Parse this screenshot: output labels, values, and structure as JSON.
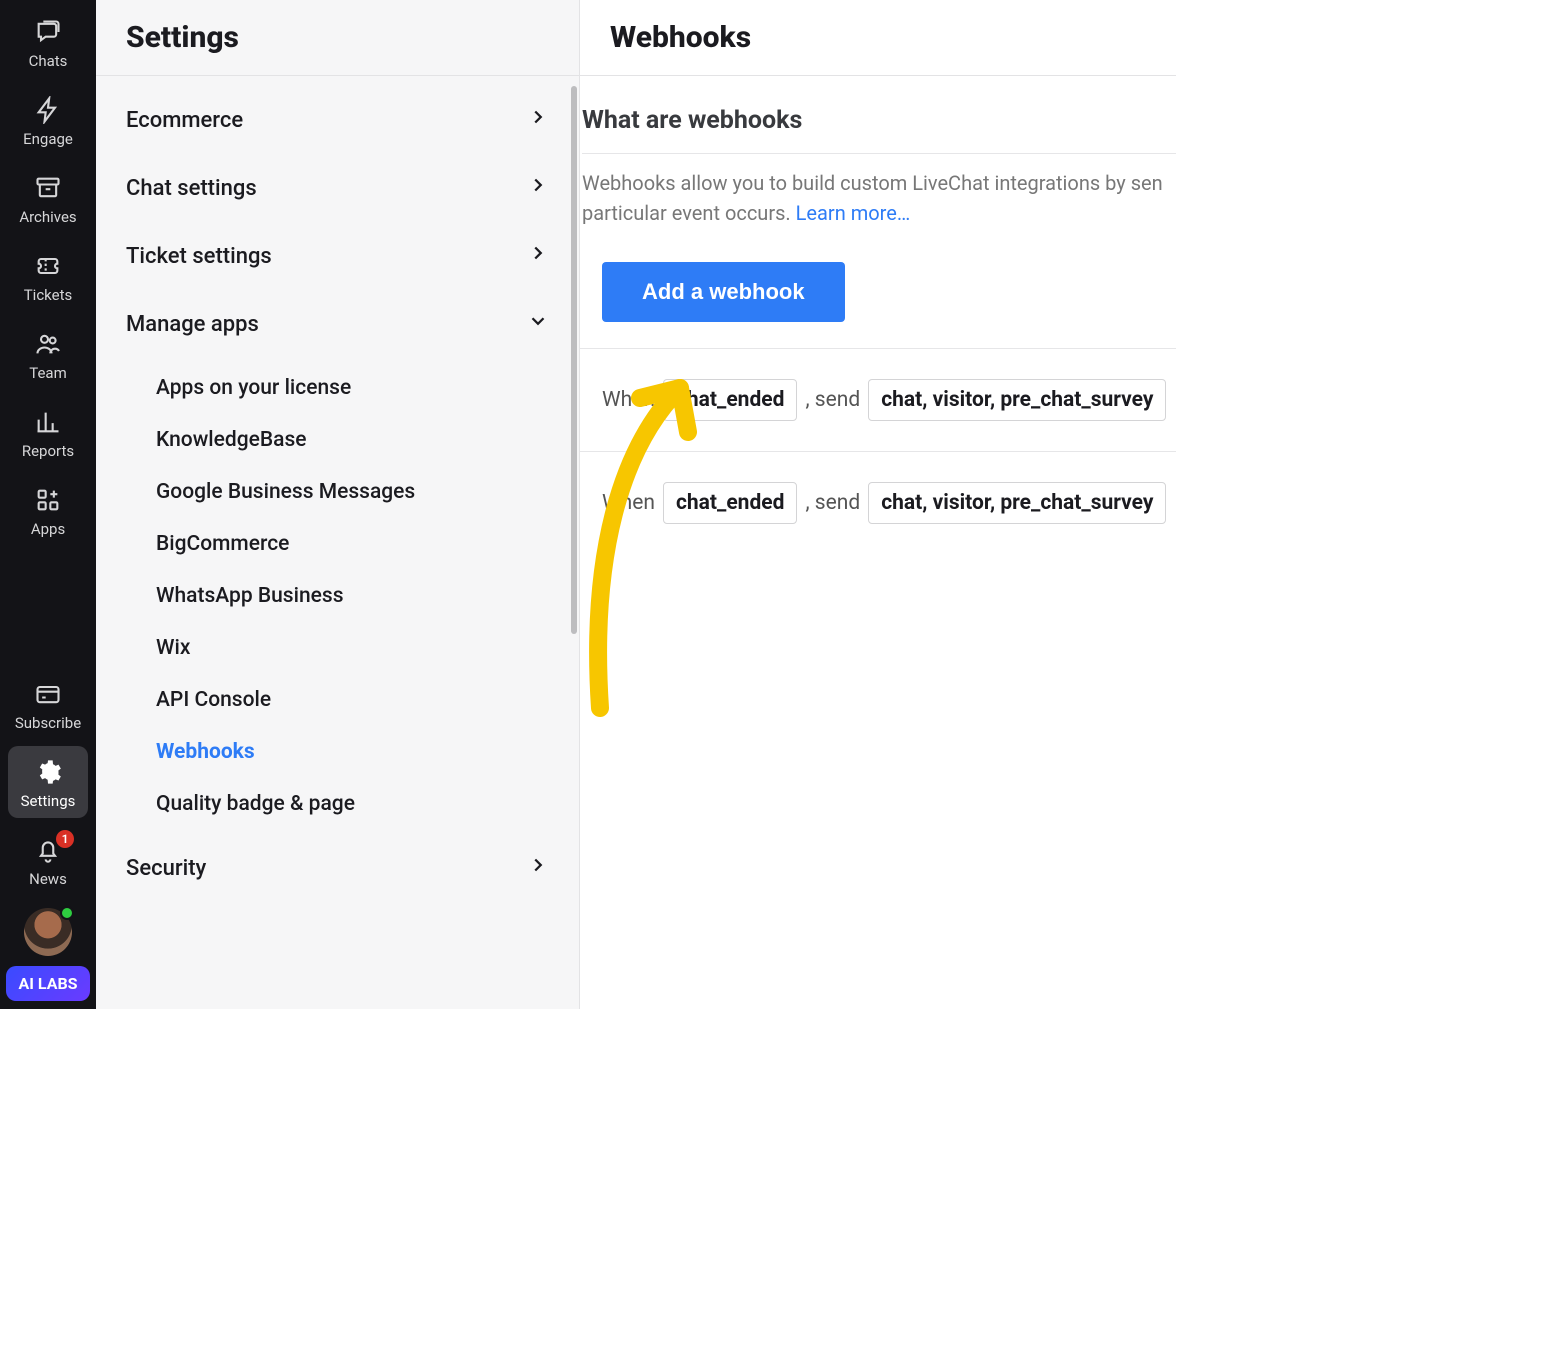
{
  "rail": {
    "items": [
      {
        "key": "chats",
        "label": "Chats"
      },
      {
        "key": "engage",
        "label": "Engage"
      },
      {
        "key": "archives",
        "label": "Archives"
      },
      {
        "key": "tickets",
        "label": "Tickets"
      },
      {
        "key": "team",
        "label": "Team"
      },
      {
        "key": "reports",
        "label": "Reports"
      },
      {
        "key": "apps",
        "label": "Apps"
      }
    ],
    "subscribe_label": "Subscribe",
    "settings_label": "Settings",
    "news_label": "News",
    "news_badge": "1",
    "ai_labs_label": "AI LABS"
  },
  "settings": {
    "title": "Settings",
    "sections": [
      {
        "label": "Ecommerce",
        "expanded": false
      },
      {
        "label": "Chat settings",
        "expanded": false
      },
      {
        "label": "Ticket settings",
        "expanded": false
      },
      {
        "label": "Manage apps",
        "expanded": true,
        "items": [
          "Apps on your license",
          "KnowledgeBase",
          "Google Business Messages",
          "BigCommerce",
          "WhatsApp Business",
          "Wix",
          "API Console",
          "Webhooks",
          "Quality badge & page"
        ],
        "active_item": "Webhooks"
      },
      {
        "label": "Security",
        "expanded": false
      }
    ]
  },
  "main": {
    "title": "Webhooks",
    "section_title": "What are webhooks",
    "description_prefix": "Webhooks allow you to build custom LiveChat integrations by sen",
    "description_line2": "particular event occurs. ",
    "learn_more": "Learn more…",
    "add_button": "Add a webhook",
    "rules": [
      {
        "when": "When",
        "event": "chat_ended",
        "sep": ", send",
        "payload": "chat, visitor, pre_chat_survey"
      },
      {
        "when": "When",
        "event": "chat_ended",
        "sep": ", send",
        "payload": "chat, visitor, pre_chat_survey"
      }
    ]
  }
}
